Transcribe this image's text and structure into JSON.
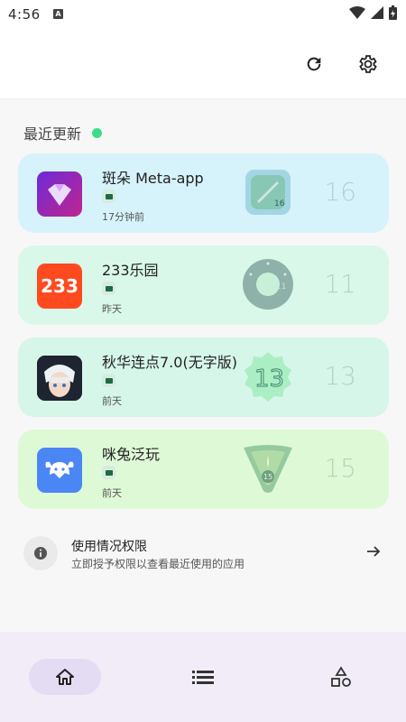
{
  "status_bar": {
    "time": "4:56",
    "notif_letter": "A"
  },
  "toolbar": {
    "refresh_icon": "refresh-icon",
    "settings_icon": "gear-icon"
  },
  "section": {
    "title": "最近更新",
    "dot_color": "#3ddb88"
  },
  "apps": [
    {
      "name": "斑朵 Meta-app",
      "time": "17分钟前",
      "api": "16",
      "card_color": "#d6f3fb",
      "icon": "meta-app-icon"
    },
    {
      "name": "233乐园",
      "time": "昨天",
      "api": "11",
      "card_color": "#d9f8ea",
      "icon": "233-icon",
      "icon_text": "233"
    },
    {
      "name": "秋华连点7.0(无字版)",
      "time": "前天",
      "api": "13",
      "card_color": "#d6f6ea",
      "icon": "anime-avatar-icon"
    },
    {
      "name": "咪兔泛玩",
      "time": "前天",
      "api": "15",
      "card_color": "#def9d6",
      "icon": "bunny-icon"
    }
  ],
  "permission": {
    "title": "使用情况权限",
    "description": "立即授予权限以查看最近使用的应用"
  },
  "bottom_nav": {
    "items": [
      "home-icon",
      "list-icon",
      "shapes-icon"
    ],
    "active": 0
  }
}
